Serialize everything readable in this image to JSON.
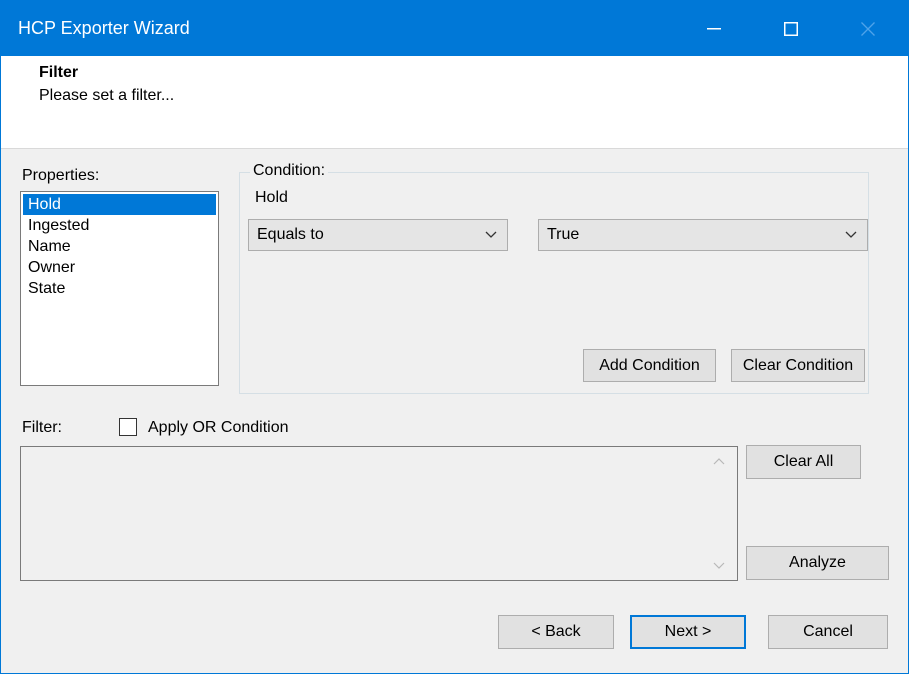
{
  "window": {
    "title": "HCP Exporter Wizard",
    "accent": "#0078d7"
  },
  "header": {
    "title": "Filter",
    "subtitle": "Please set a filter..."
  },
  "properties": {
    "label": "Properties:",
    "items": [
      "Hold",
      "Ingested",
      "Name",
      "Owner",
      "State"
    ],
    "selected_index": 0
  },
  "condition": {
    "legend": "Condition:",
    "property": "Hold",
    "operator": "Equals to",
    "value": "True",
    "add_label": "Add Condition",
    "clear_label": "Clear Condition"
  },
  "filter": {
    "label": "Filter:",
    "or_checkbox_label": "Apply OR Condition",
    "or_checked": false,
    "text": "",
    "clear_all_label": "Clear All",
    "analyze_label": "Analyze"
  },
  "footer": {
    "back_label": "< Back",
    "next_label": "Next >",
    "cancel_label": "Cancel"
  }
}
